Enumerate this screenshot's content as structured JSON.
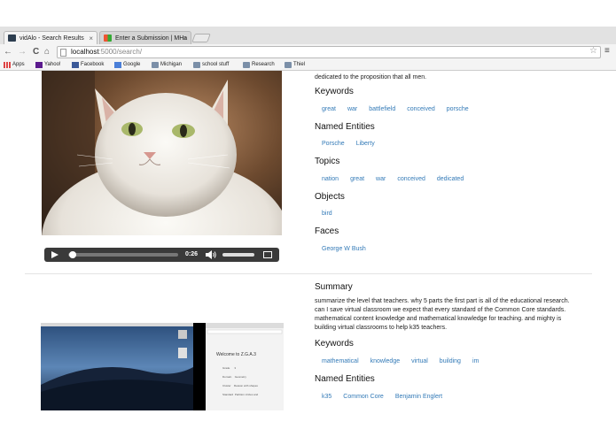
{
  "tabs": [
    {
      "title": "vidAlo - Search Results",
      "close": "×",
      "active": true
    },
    {
      "title": "Enter a Submission | MHa",
      "close": "×",
      "active": false
    }
  ],
  "nav": {
    "back": "←",
    "forward": "→",
    "reload": "C",
    "home": "⌂"
  },
  "url": {
    "host": "localhost",
    "path": ":5000/search/"
  },
  "star": "☆",
  "menu": "≡",
  "bookmarks": [
    {
      "label": "Apps",
      "icon": "apps-grid-icon"
    },
    {
      "label": "Yahoo!",
      "icon": "yahoo-icon"
    },
    {
      "label": "Facebook",
      "icon": "facebook-icon"
    },
    {
      "label": "Google",
      "icon": "google-icon"
    },
    {
      "label": "Michigan",
      "icon": "folder-icon"
    },
    {
      "label": "school stuff",
      "icon": "folder-icon"
    },
    {
      "label": "Research",
      "icon": "folder-icon"
    },
    {
      "label": "Thiel",
      "icon": "folder-icon"
    }
  ],
  "result1": {
    "summary_tail": "dedicated to the proposition that all men.",
    "keywords_heading": "Keywords",
    "keywords": [
      "great",
      "war",
      "battlefield",
      "conceived",
      "porsche"
    ],
    "entities_heading": "Named Entities",
    "entities": [
      "Porsche",
      "Liberty"
    ],
    "topics_heading": "Topics",
    "topics": [
      "nation",
      "great",
      "war",
      "conceived",
      "dedicated"
    ],
    "objects_heading": "Objects",
    "objects": [
      "bird"
    ],
    "faces_heading": "Faces",
    "faces": [
      "George W Bush"
    ],
    "player": {
      "time": "0:26",
      "progress": 0.04,
      "volume": 1.0
    }
  },
  "result2": {
    "summary_heading": "Summary",
    "summary": "summarize the level that teachers. why 5 parts the first part is all of the educational research. can I save virtual classroom we expect that every standard of the Common Core standards. mathematical content knowledge and mathematical knowledge for teaching. and mighty is building virtual classrooms to help k35 teachers.",
    "keywords_heading": "Keywords",
    "keywords": [
      "mathematical",
      "knowledge",
      "virtual",
      "building",
      "im"
    ],
    "entities_heading": "Named Entities",
    "entities": [
      "k35",
      "Common Core",
      "Benjamin Englert"
    ],
    "thumb_text": {
      "title": "Welcome to Z.G.A.3",
      "rows": [
        [
          "Grade",
          "3"
        ],
        [
          "Domain",
          "Geometry"
        ],
        [
          "Cluster",
          "Reason with shapes"
        ],
        [
          "Standard",
          "Partition circles and"
        ]
      ]
    }
  },
  "colors": {
    "link": "#337ab7",
    "tab_bg": "#e2e2e2",
    "player": "#3a3a3a"
  }
}
